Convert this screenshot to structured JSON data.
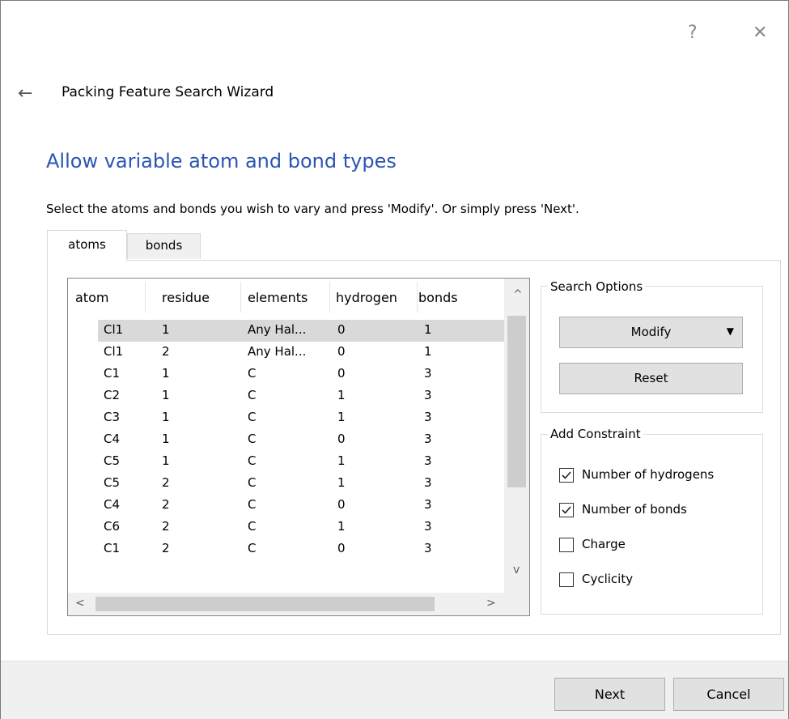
{
  "titlebar": {
    "help_glyph": "?",
    "close_glyph": "✕"
  },
  "wizard": {
    "back_glyph": "←",
    "title": "Packing Feature Search Wizard"
  },
  "page": {
    "heading": "Allow variable atom and bond types",
    "instruction": "Select the atoms and bonds you wish to vary and press 'Modify'. Or simply press 'Next'."
  },
  "tabs": [
    {
      "label": "atoms",
      "active": true
    },
    {
      "label": "bonds",
      "active": false
    }
  ],
  "table": {
    "columns": [
      "atom",
      "residue",
      "elements",
      "hydrogen",
      "bonds"
    ],
    "rows": [
      {
        "atom": "Cl1",
        "residue": "1",
        "elements": "Any Hal...",
        "hydrogen": "0",
        "bonds": "1",
        "selected": true
      },
      {
        "atom": "Cl1",
        "residue": "2",
        "elements": "Any Hal...",
        "hydrogen": "0",
        "bonds": "1"
      },
      {
        "atom": "C1",
        "residue": "1",
        "elements": "C",
        "hydrogen": "0",
        "bonds": "3"
      },
      {
        "atom": "C2",
        "residue": "1",
        "elements": "C",
        "hydrogen": "1",
        "bonds": "3"
      },
      {
        "atom": "C3",
        "residue": "1",
        "elements": "C",
        "hydrogen": "1",
        "bonds": "3"
      },
      {
        "atom": "C4",
        "residue": "1",
        "elements": "C",
        "hydrogen": "0",
        "bonds": "3"
      },
      {
        "atom": "C5",
        "residue": "1",
        "elements": "C",
        "hydrogen": "1",
        "bonds": "3"
      },
      {
        "atom": "C5",
        "residue": "2",
        "elements": "C",
        "hydrogen": "1",
        "bonds": "3"
      },
      {
        "atom": "C4",
        "residue": "2",
        "elements": "C",
        "hydrogen": "0",
        "bonds": "3"
      },
      {
        "atom": "C6",
        "residue": "2",
        "elements": "C",
        "hydrogen": "1",
        "bonds": "3"
      },
      {
        "atom": "C1",
        "residue": "2",
        "elements": "C",
        "hydrogen": "0",
        "bonds": "3"
      }
    ],
    "scroll_up": "^",
    "scroll_down": "v",
    "scroll_left": "<",
    "scroll_right": ">"
  },
  "search_options": {
    "title": "Search Options",
    "modify_label": "Modify",
    "modify_arrow": "▼",
    "reset_label": "Reset"
  },
  "add_constraint": {
    "title": "Add Constraint",
    "items": [
      {
        "label": "Number of hydrogens",
        "checked": true
      },
      {
        "label": "Number of bonds",
        "checked": true
      },
      {
        "label": "Charge",
        "checked": false
      },
      {
        "label": "Cyclicity",
        "checked": false
      }
    ]
  },
  "footer": {
    "next_label": "Next",
    "cancel_label": "Cancel"
  }
}
